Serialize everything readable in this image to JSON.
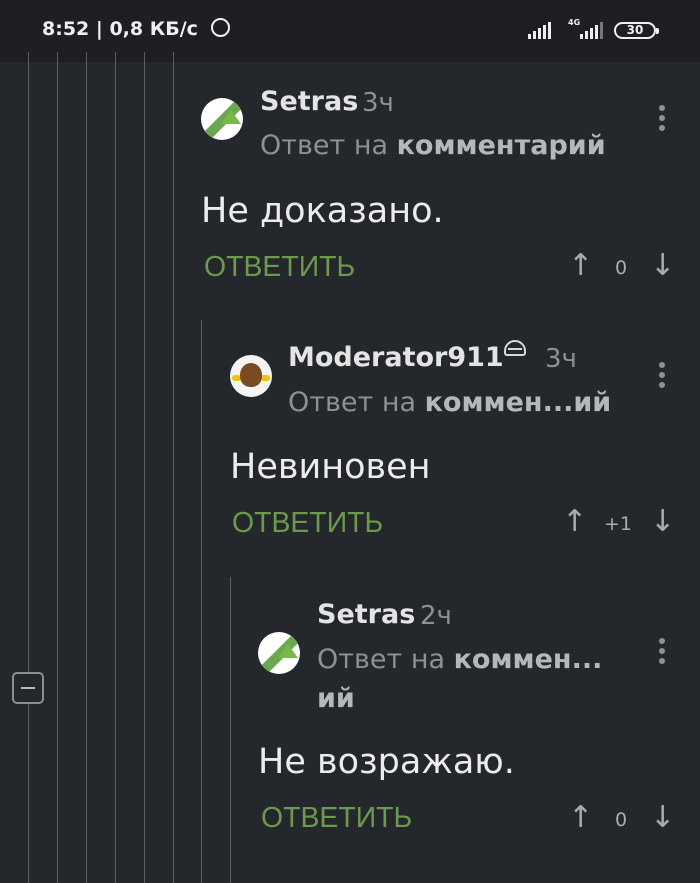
{
  "status_bar": {
    "time": "8:52",
    "speed": "0,8 КБ/с",
    "network": "4G",
    "battery": "30"
  },
  "comments": [
    {
      "username": "Setras",
      "time": "3ч",
      "reply_prefix": "Ответ на",
      "reply_target": "комментарий",
      "text": "Не доказано.",
      "reply_label": "ОТВЕТИТЬ",
      "score": "0",
      "avatar": "leroy-merlin-avatar"
    },
    {
      "username": "Moderator911",
      "time": "3ч",
      "reply_prefix": "Ответ на",
      "reply_target": "коммен...ий",
      "text": "Невиновен",
      "reply_label": "ОТВЕТИТЬ",
      "score": "+1",
      "avatar": "moderator-avatar",
      "badge": "moderator-hat-icon"
    },
    {
      "username": "Setras",
      "time": "2ч",
      "reply_prefix": "Ответ на",
      "reply_target": "коммен...",
      "reply_target_cont": "ий",
      "text": "Не возражаю.",
      "reply_label": "ОТВЕТИТЬ",
      "score": "0",
      "avatar": "leroy-merlin-avatar"
    }
  ],
  "colors": {
    "background": "#24272b",
    "accent_green": "#6c9a4b",
    "muted": "#8d9196"
  }
}
